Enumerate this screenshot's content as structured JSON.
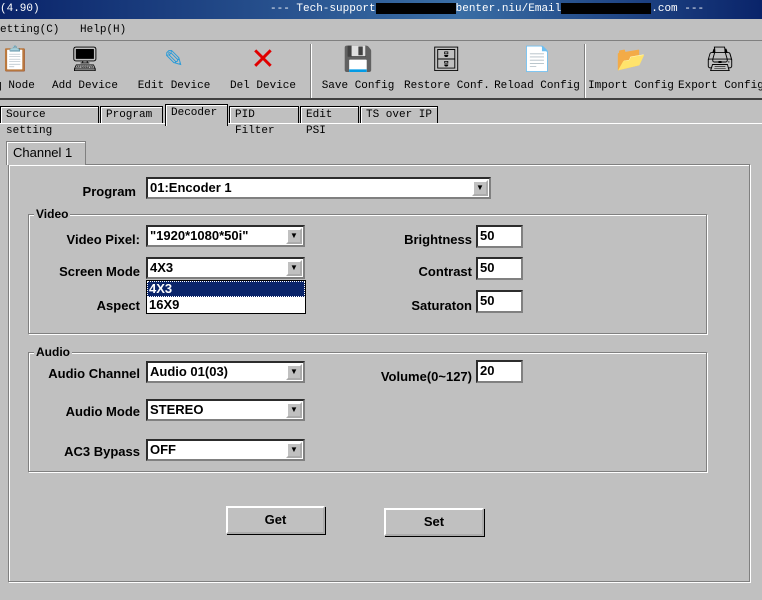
{
  "title": {
    "version": "(4.90)",
    "support_prefix": "--- Tech-support",
    "support_mid": "benter.niu/Email",
    "support_suffix": ".com ---"
  },
  "menu": [
    "etting(C)",
    "Help(H)"
  ],
  "toolbar": [
    {
      "label": "q Node",
      "icon": "node-icon"
    },
    {
      "label": "Add Device",
      "icon": "add-device-icon"
    },
    {
      "label": "Edit Device",
      "icon": "edit-device-icon"
    },
    {
      "label": "Del Device",
      "icon": "delete-icon"
    },
    {
      "label": "Save Config",
      "icon": "save-icon"
    },
    {
      "label": "Restore Conf.",
      "icon": "restore-icon"
    },
    {
      "label": "Reload Config",
      "icon": "reload-icon"
    },
    {
      "label": "Import Config",
      "icon": "import-icon"
    },
    {
      "label": "Export Config",
      "icon": "export-icon"
    }
  ],
  "tabs": [
    "Source setting",
    "Program",
    "Decoder",
    "PID Filter",
    "Edit PSI",
    "TS over IP"
  ],
  "active_tab": "Decoder",
  "channel_tab": "Channel 1",
  "program": {
    "label": "Program",
    "value": "01:Encoder 1"
  },
  "video": {
    "legend": "Video",
    "pixel": {
      "label": "Video Pixel:",
      "value": "\"1920*1080*50i\""
    },
    "screen_mode": {
      "label": "Screen Mode",
      "value": "4X3",
      "options": [
        "4X3",
        "16X9"
      ]
    },
    "aspect": {
      "label": "Aspect"
    },
    "brightness": {
      "label": "Brightness",
      "value": "50"
    },
    "contrast": {
      "label": "Contrast",
      "value": "50"
    },
    "saturation": {
      "label": "Saturaton",
      "value": "50"
    }
  },
  "audio": {
    "legend": "Audio",
    "channel": {
      "label": "Audio Channel",
      "value": "Audio 01(03)"
    },
    "mode": {
      "label": "Audio Mode",
      "value": "STEREO"
    },
    "ac3": {
      "label": "AC3 Bypass",
      "value": "OFF"
    },
    "volume": {
      "label": "Volume(0~127)",
      "value": "20"
    }
  },
  "buttons": {
    "get": "Get",
    "set": "Set"
  }
}
